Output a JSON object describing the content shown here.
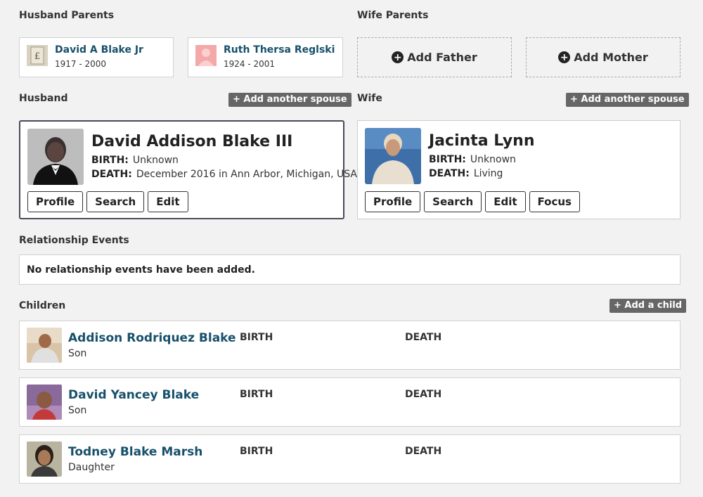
{
  "husband_parents": {
    "title": "Husband Parents",
    "father": {
      "name": "David A Blake Jr",
      "dates": "1917 - 2000"
    },
    "mother": {
      "name": "Ruth Thersa Reglski",
      "dates": "1924 - 2001"
    }
  },
  "wife_parents": {
    "title": "Wife Parents",
    "add_father": "Add Father",
    "add_mother": "Add Mother"
  },
  "husband": {
    "title": "Husband",
    "add_spouse": "+ Add another spouse",
    "name": "David Addison Blake III",
    "birth_label": "BIRTH:",
    "birth": "Unknown",
    "death_label": "DEATH:",
    "death": "December 2016 in Ann Arbor, Michigan, USA",
    "buttons": {
      "profile": "Profile",
      "search": "Search",
      "edit": "Edit"
    }
  },
  "wife": {
    "title": "Wife",
    "add_spouse": "+ Add another spouse",
    "name": "Jacinta Lynn",
    "birth_label": "BIRTH:",
    "birth": "Unknown",
    "death_label": "DEATH:",
    "death": "Living",
    "buttons": {
      "profile": "Profile",
      "search": "Search",
      "edit": "Edit",
      "focus": "Focus"
    }
  },
  "relationship_events": {
    "title": "Relationship Events",
    "empty_message": "No relationship events have been added."
  },
  "children": {
    "title": "Children",
    "add_child": "+ Add a child",
    "birth_col": "BIRTH",
    "death_col": "DEATH",
    "items": [
      {
        "name": "Addison Rodriquez Blake",
        "relation": "Son"
      },
      {
        "name": "David Yancey Blake",
        "relation": "Son"
      },
      {
        "name": "Todney Blake Marsh",
        "relation": "Daughter"
      }
    ]
  },
  "colors": {
    "link": "#17506b",
    "pill_bg": "#666666",
    "selected_border": "#4a4a5a",
    "page_bg": "#f2f2f2"
  }
}
